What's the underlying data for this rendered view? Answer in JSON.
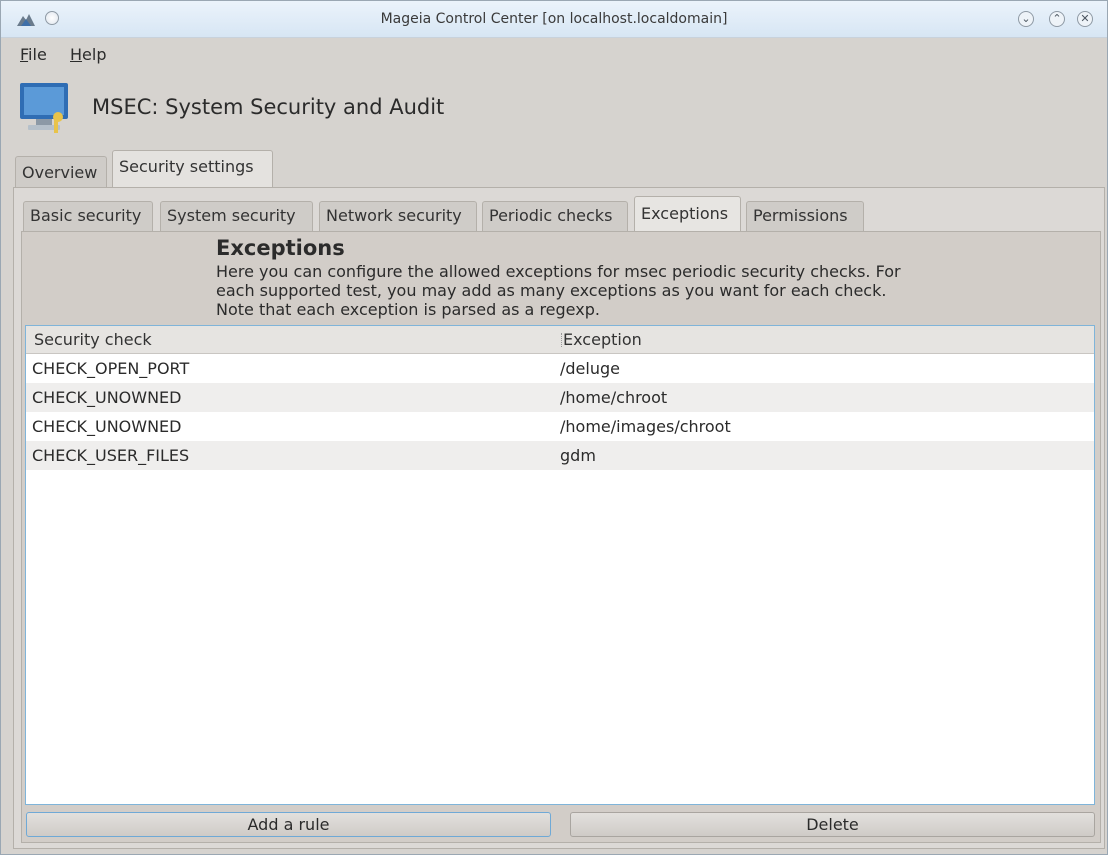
{
  "window": {
    "title": "Mageia Control Center  [on localhost.localdomain]",
    "controls": {
      "minimize": "⌄",
      "maximize": "⌃",
      "close": "✕"
    }
  },
  "menu": {
    "file": {
      "accel": "F",
      "rest": "ile"
    },
    "help": {
      "accel": "H",
      "rest": "elp"
    }
  },
  "header": {
    "title": "MSEC: System Security and Audit",
    "icon": "security-monitor-icon"
  },
  "outer_tabs": [
    "Overview",
    "Security settings"
  ],
  "outer_active": "Security settings",
  "inner_tabs": [
    "Basic security",
    "System security",
    "Network security",
    "Periodic checks",
    "Exceptions",
    "Permissions"
  ],
  "inner_active": "Exceptions",
  "section": {
    "title": "Exceptions",
    "description": "Here you can configure the allowed exceptions for msec periodic security checks. For each supported test, you may add as many exceptions as you want for each check. Note that each exception is parsed as a regexp."
  },
  "table": {
    "columns": [
      "Security check",
      "Exception"
    ],
    "rows": [
      [
        "CHECK_OPEN_PORT",
        "/deluge"
      ],
      [
        "CHECK_UNOWNED",
        "/home/chroot"
      ],
      [
        "CHECK_UNOWNED",
        "/home/images/chroot"
      ],
      [
        "CHECK_USER_FILES",
        "gdm"
      ]
    ]
  },
  "buttons": {
    "add": "Add a rule",
    "delete": "Delete"
  },
  "colors": {
    "accent": "#7fb4d9",
    "titlebar": "#dde9f5",
    "background": "#d6d3cf"
  }
}
